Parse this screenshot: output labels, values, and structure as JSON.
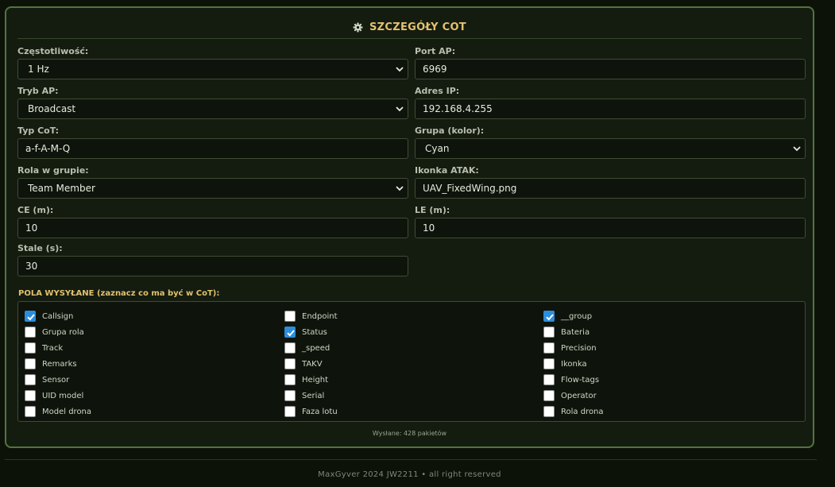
{
  "panel": {
    "title": "SZCZEGÓŁY COT",
    "icon": "gear-icon",
    "accent_color": "#e3c16f",
    "border_color": "#55733f"
  },
  "fields": {
    "frequency": {
      "label": "Częstotliwość:",
      "value": "1 Hz"
    },
    "ap_port": {
      "label": "Port AP:",
      "value": "6969"
    },
    "ap_mode": {
      "label": "Tryb AP:",
      "value": "Broadcast"
    },
    "ip_address": {
      "label": "Adres IP:",
      "value": "192.168.4.255"
    },
    "cot_type": {
      "label": "Typ CoT:",
      "value": "a-f-A-M-Q"
    },
    "group_color": {
      "label": "Grupa (kolor):",
      "value": "Cyan"
    },
    "group_role": {
      "label": "Rola w grupie:",
      "value": "Team Member"
    },
    "atak_icon": {
      "label": "Ikonka ATAK:",
      "value": "UAV_FixedWing.png"
    },
    "ce": {
      "label": "CE (m):",
      "value": "10"
    },
    "le": {
      "label": "LE (m):",
      "value": "10"
    },
    "stale": {
      "label": "Stale (s):",
      "value": "30"
    }
  },
  "sent_fields": {
    "title": "POLA WYSYŁANE (zaznacz co ma być w CoT):",
    "checkbox_color": "#2c8ddb",
    "columns": [
      [
        {
          "label": "Callsign",
          "checked": true
        },
        {
          "label": "Grupa rola",
          "checked": false
        },
        {
          "label": "Track",
          "checked": false
        },
        {
          "label": "Remarks",
          "checked": false
        },
        {
          "label": "Sensor",
          "checked": false
        },
        {
          "label": "UID model",
          "checked": false
        },
        {
          "label": "Model drona",
          "checked": false
        }
      ],
      [
        {
          "label": "Endpoint",
          "checked": false
        },
        {
          "label": "Status",
          "checked": true
        },
        {
          "label": "_speed",
          "checked": false
        },
        {
          "label": "TAKV",
          "checked": false
        },
        {
          "label": "Height",
          "checked": false
        },
        {
          "label": "Serial",
          "checked": false
        },
        {
          "label": "Faza lotu",
          "checked": false
        }
      ],
      [
        {
          "label": "__group",
          "checked": true
        },
        {
          "label": "Bateria",
          "checked": false
        },
        {
          "label": "Precision",
          "checked": false
        },
        {
          "label": "Ikonka",
          "checked": false
        },
        {
          "label": "Flow-tags",
          "checked": false
        },
        {
          "label": "Operator",
          "checked": false
        },
        {
          "label": "Rola drona",
          "checked": false
        }
      ]
    ]
  },
  "status": {
    "sent_text": "Wysłane: 428 pakietów"
  },
  "footer": {
    "text": "MaxGyver 2024 JW2211 • all right reserved"
  }
}
